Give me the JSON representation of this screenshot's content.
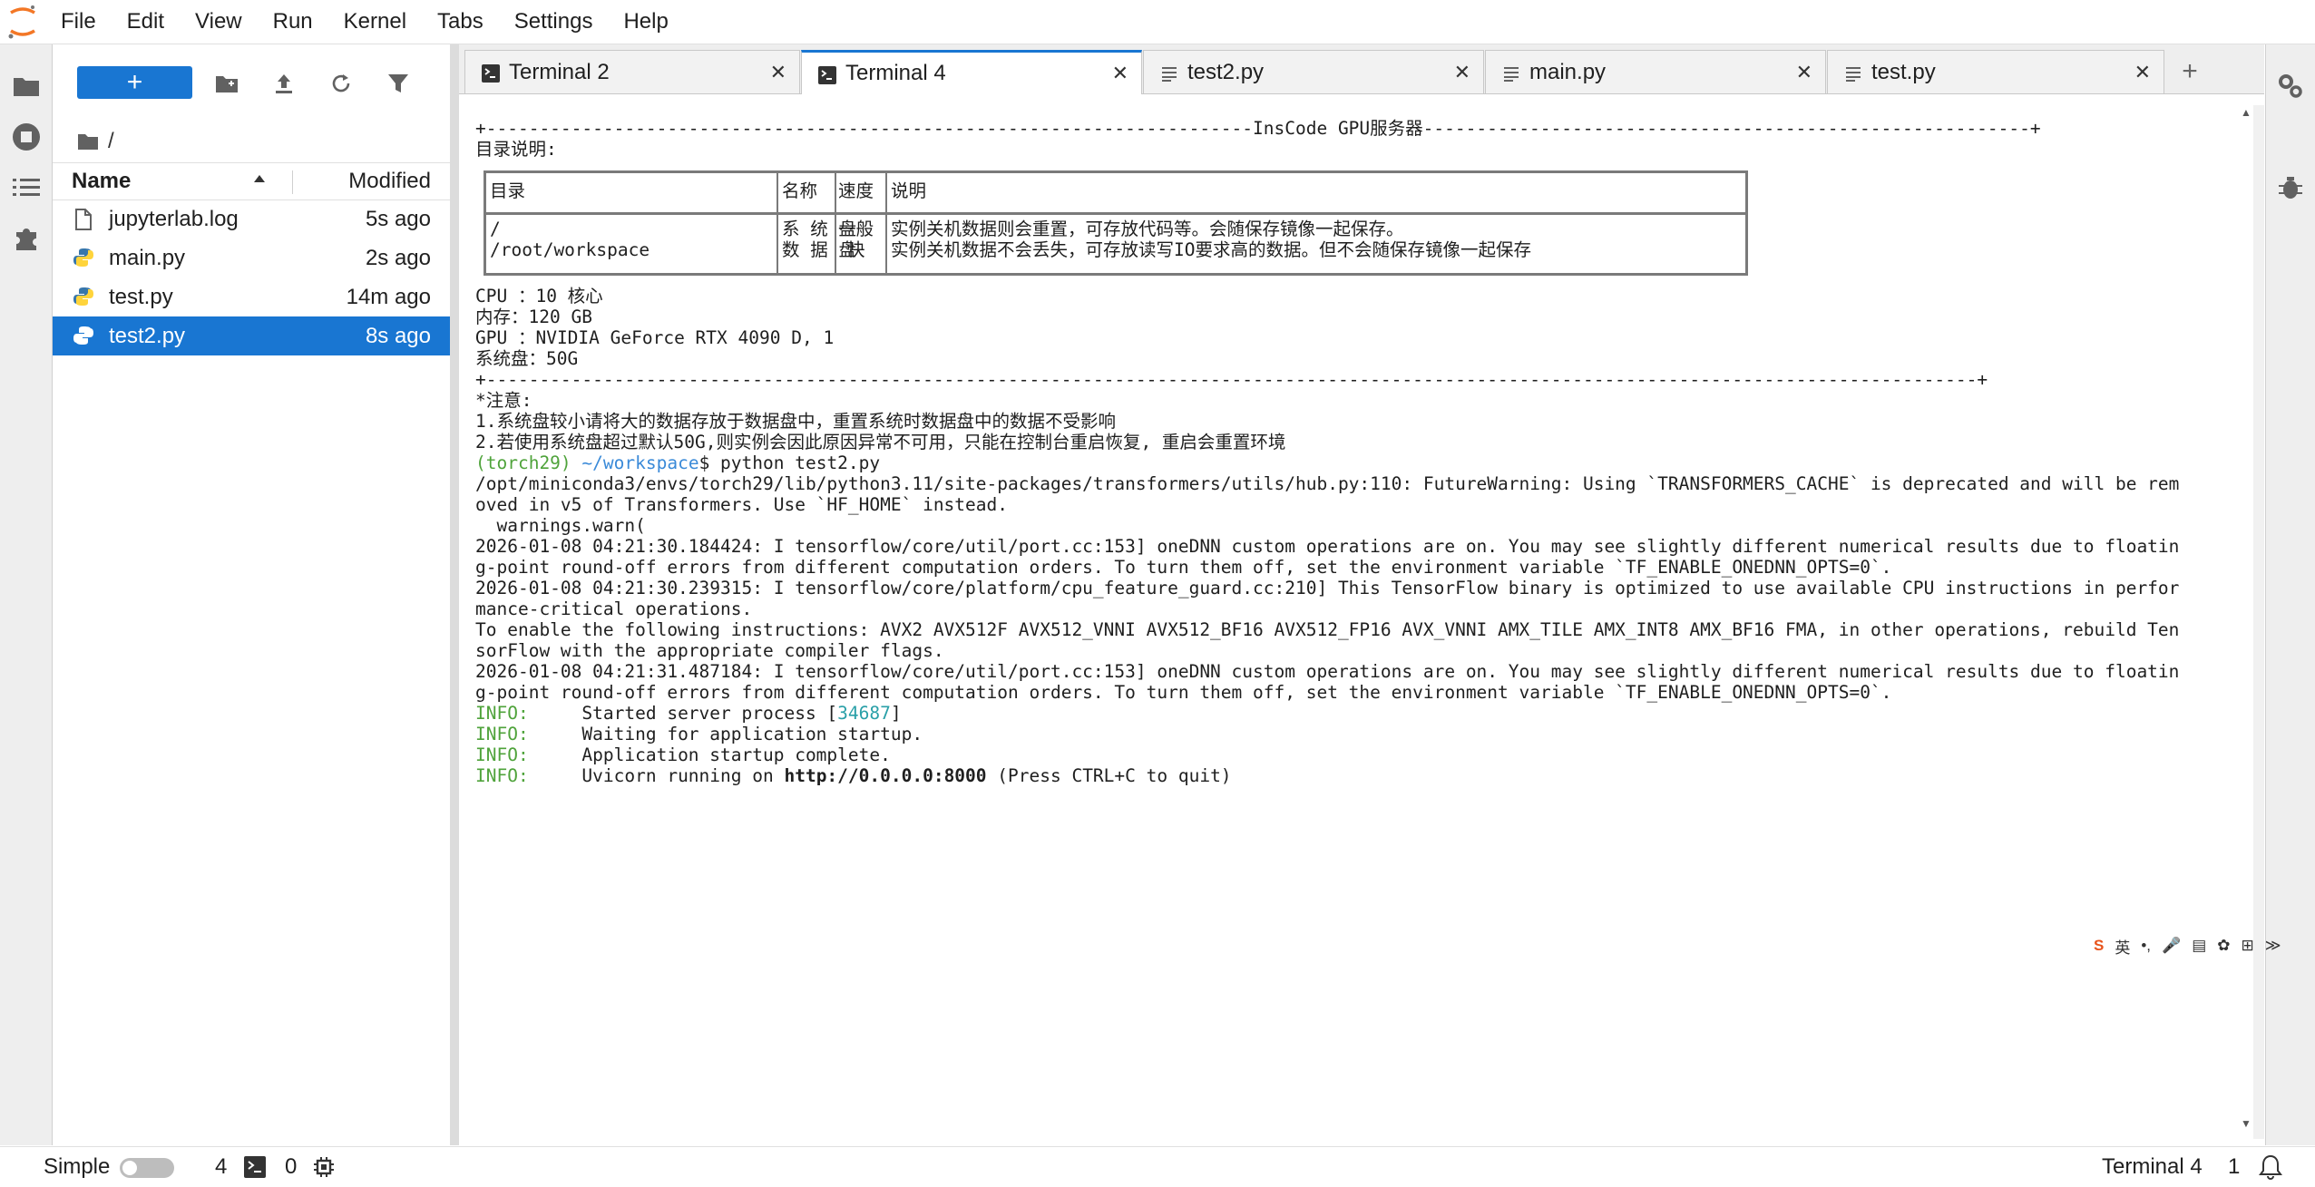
{
  "menubar": {
    "items": [
      "File",
      "Edit",
      "View",
      "Run",
      "Kernel",
      "Tabs",
      "Settings",
      "Help"
    ]
  },
  "leftbar": {
    "icons": [
      "folder-icon",
      "running-icon",
      "toc-icon",
      "extension-icon"
    ]
  },
  "rightbar": {
    "icons": [
      "property-inspector-icon",
      "debugger-icon"
    ]
  },
  "filebrowser": {
    "new_label": "+",
    "breadcrumb": "/",
    "col_name": "Name",
    "col_modified": "Modified",
    "files": [
      {
        "name": "jupyterlab.log",
        "modified": "5s ago",
        "icon": "file-icon",
        "selected": false
      },
      {
        "name": "main.py",
        "modified": "2s ago",
        "icon": "python-icon",
        "selected": false
      },
      {
        "name": "test.py",
        "modified": "14m ago",
        "icon": "python-icon",
        "selected": false
      },
      {
        "name": "test2.py",
        "modified": "8s ago",
        "icon": "python-icon",
        "selected": true
      }
    ]
  },
  "tabs": [
    {
      "label": "Terminal 2",
      "icon": "terminal-icon",
      "active": false
    },
    {
      "label": "Terminal 4",
      "icon": "terminal-icon",
      "active": true
    },
    {
      "label": "test2.py",
      "icon": "text-file-icon",
      "active": false
    },
    {
      "label": "main.py",
      "icon": "text-file-icon",
      "active": false
    },
    {
      "label": "test.py",
      "icon": "text-file-icon",
      "active": false
    }
  ],
  "terminal": {
    "banner": "+------------------------------------------------------------------------InsCode GPU服务器---------------------------------------------------------+",
    "dir_title": "目录说明:",
    "table": {
      "headers": [
        "目录",
        "名称",
        "速度",
        "说明"
      ],
      "rows": [
        [
          "/",
          "系 统 盘",
          "一般",
          "实例关机数据则会重置，可存放代码等。会随保存镜像一起保存。"
        ],
        [
          "/root/workspace",
          "数 据 盘",
          "快",
          "实例关机数据不会丢失，可存放读写IO要求高的数据。但不会随保存镜像一起保存"
        ]
      ]
    },
    "specs": [
      "CPU ：10 核心",
      "内存：120 GB",
      "GPU ：NVIDIA GeForce RTX 4090 D, 1",
      "系统盘：50G"
    ],
    "rule": "+--------------------------------------------------------------------------------------------------------------------------------------------+",
    "notes": [
      "*注意:",
      "1.系统盘较小请将大的数据存放于数据盘中，重置系统时数据盘中的数据不受影响",
      "2.若使用系统盘超过默认50G,则实例会因此原因异常不可用，只能在控制台重启恢复, 重启会重置环境"
    ],
    "prompt_env": "(torch29)",
    "prompt_path": "~/workspace",
    "prompt_cmd": "$ python test2.py",
    "output": [
      "/opt/miniconda3/envs/torch29/lib/python3.11/site-packages/transformers/utils/hub.py:110: FutureWarning: Using `TRANSFORMERS_CACHE` is deprecated and will be rem",
      "oved in v5 of Transformers. Use `HF_HOME` instead.",
      "  warnings.warn(",
      "2026-01-08 04:21:30.184424: I tensorflow/core/util/port.cc:153] oneDNN custom operations are on. You may see slightly different numerical results due to floatin",
      "g-point round-off errors from different computation orders. To turn them off, set the environment variable `TF_ENABLE_ONEDNN_OPTS=0`.",
      "2026-01-08 04:21:30.239315: I tensorflow/core/platform/cpu_feature_guard.cc:210] This TensorFlow binary is optimized to use available CPU instructions in perfor",
      "mance-critical operations.",
      "To enable the following instructions: AVX2 AVX512F AVX512_VNNI AVX512_BF16 AVX512_FP16 AVX_VNNI AMX_TILE AMX_INT8 AMX_BF16 FMA, in other operations, rebuild Ten",
      "sorFlow with the appropriate compiler flags.",
      "2026-01-08 04:21:31.487184: I tensorflow/core/util/port.cc:153] oneDNN custom operations are on. You may see slightly different numerical results due to floatin",
      "g-point round-off errors from different computation orders. To turn them off, set the environment variable `TF_ENABLE_ONEDNN_OPTS=0`."
    ],
    "info_prefix": "INFO:",
    "info_lines": [
      {
        "pre": "Started server process [",
        "hl": "34687",
        "post": "]"
      },
      {
        "pre": "Waiting for application startup.",
        "hl": "",
        "post": ""
      },
      {
        "pre": "Application startup complete.",
        "hl": "",
        "post": ""
      },
      {
        "pre": "Uvicorn running on ",
        "hl": "http://0.0.0.0:8000",
        "post": " (Press CTRL+C to quit)"
      }
    ]
  },
  "statusbar": {
    "mode_label": "Simple",
    "terminals_count": "4",
    "kernels_count": "0",
    "active_label": "Terminal 4",
    "line_number": "1"
  },
  "ime": {
    "items": [
      "S",
      "英",
      "•,",
      "🎤",
      "▤",
      "✿",
      "⊞",
      "≫"
    ]
  },
  "colors": {
    "accent": "#1976d2",
    "prompt_green": "#4fa33b",
    "path_blue": "#3a8ad8",
    "pid_cyan": "#2aa0a8"
  }
}
